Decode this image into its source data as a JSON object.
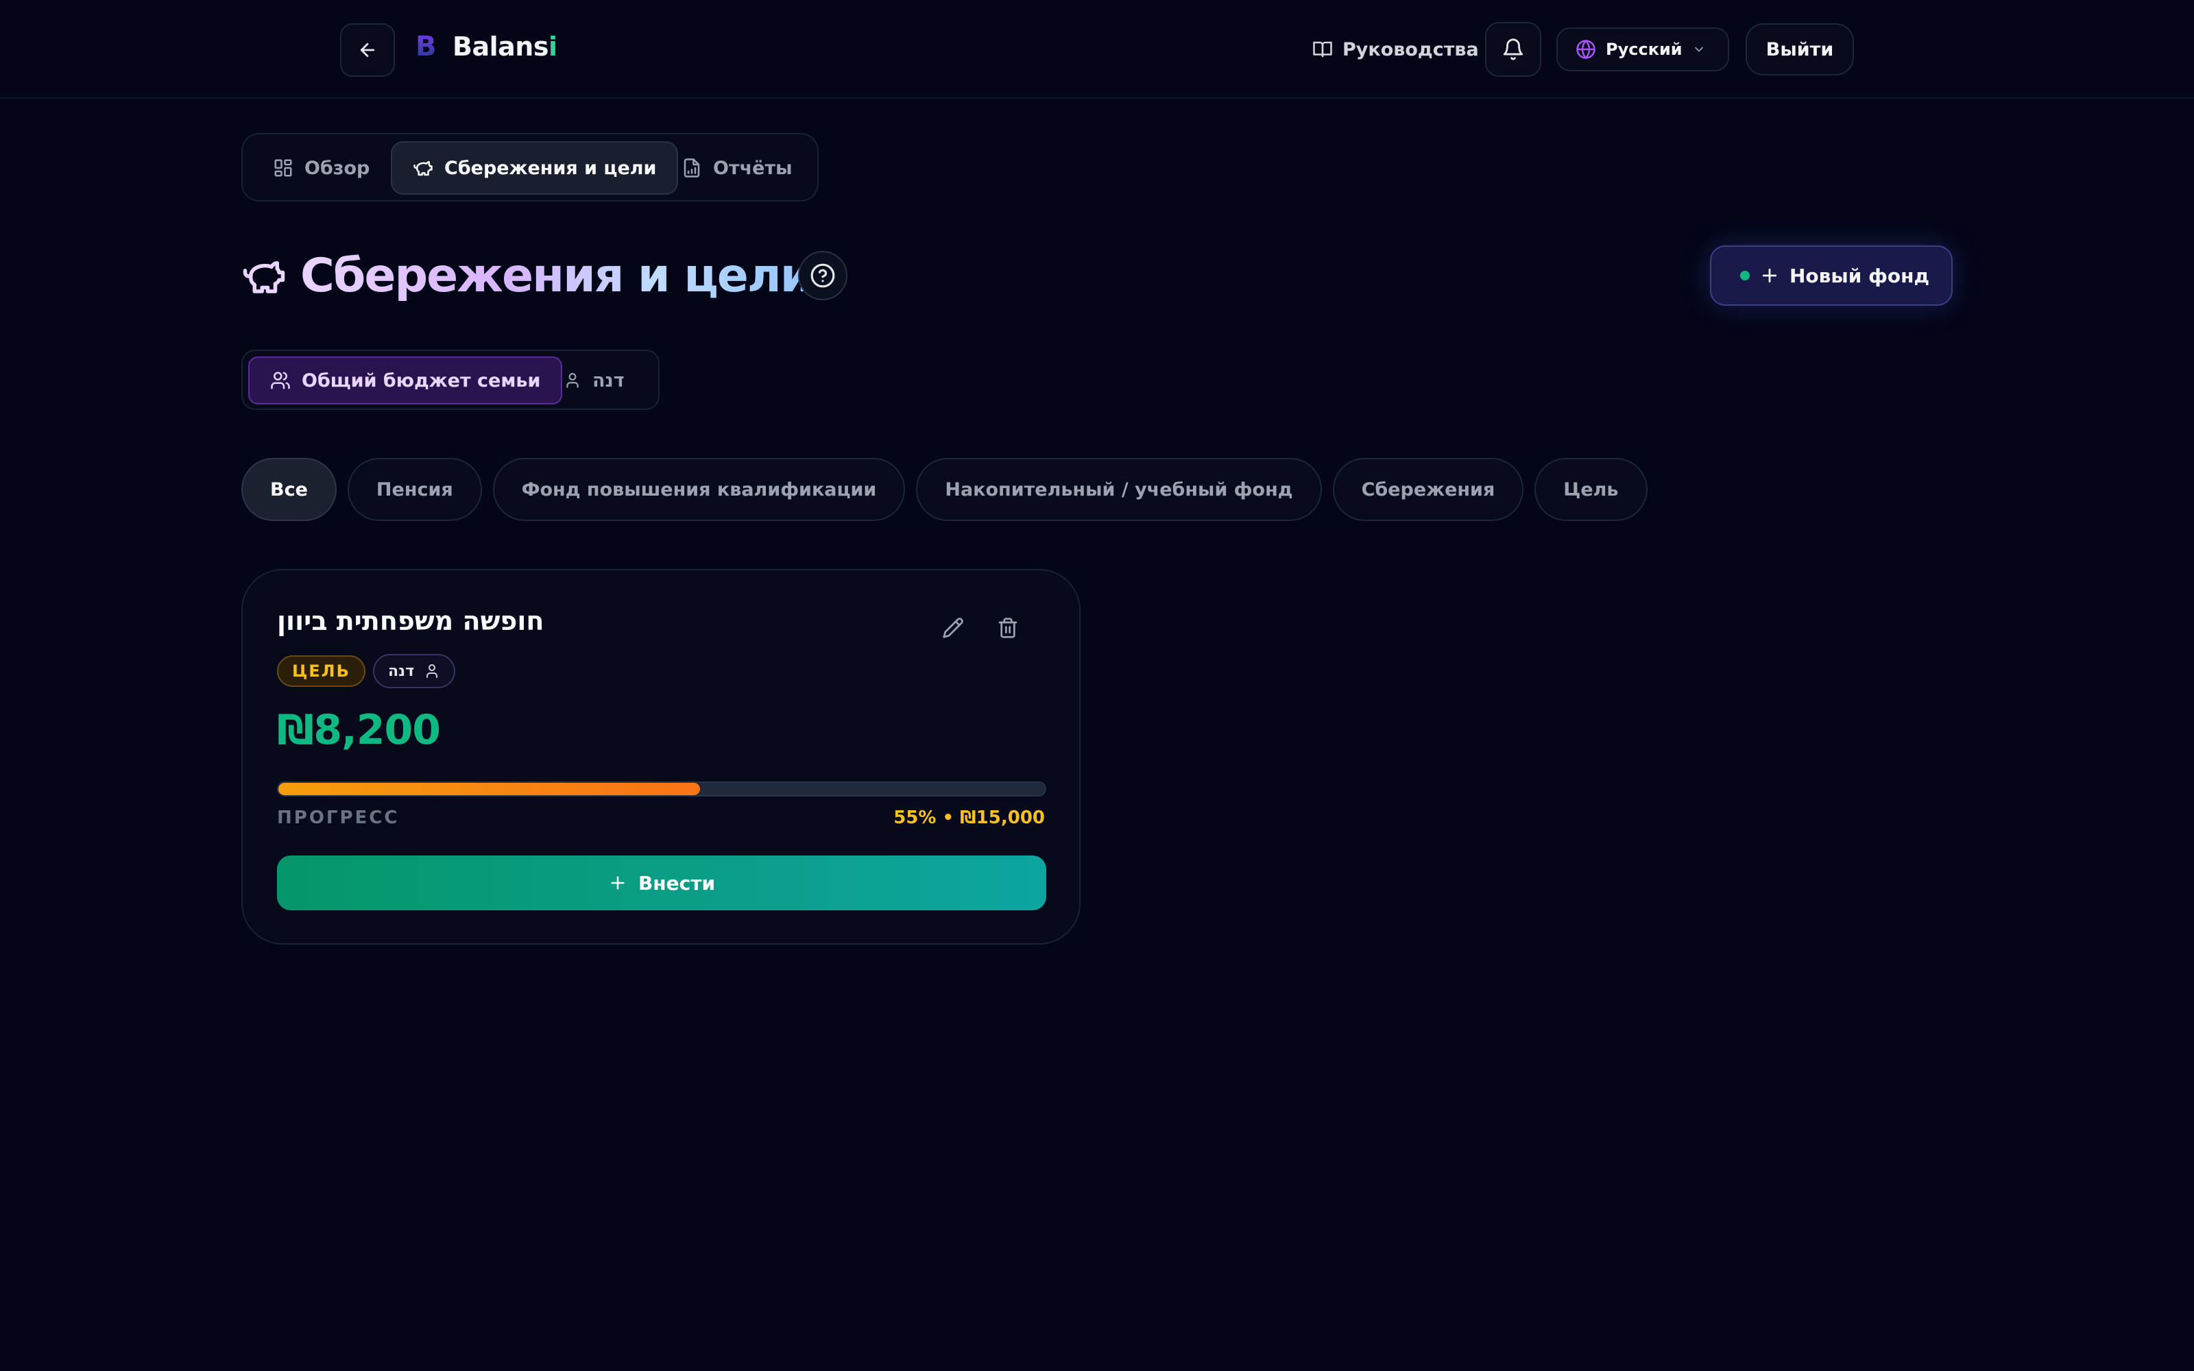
{
  "header": {
    "logo_mark": "B",
    "logo_text_main": "Balans",
    "logo_text_accent": "i",
    "guides_label": "Руководства",
    "language_label": "Русский",
    "logout_label": "Выйти"
  },
  "tabs": [
    {
      "label": "Обзор",
      "active": false,
      "icon": "grid-icon"
    },
    {
      "label": "Сбережения и цели",
      "active": true,
      "icon": "piggy-bank-icon"
    },
    {
      "label": "Отчёты",
      "active": false,
      "icon": "report-icon"
    }
  ],
  "page": {
    "title": "Сбережения и цели",
    "new_fund_label": "Новый фонд"
  },
  "scope": [
    {
      "label": "Общий бюджет семьи",
      "active": true,
      "icon": "users-icon"
    },
    {
      "label": "דנה",
      "active": false,
      "icon": "user-icon"
    }
  ],
  "filters": [
    {
      "label": "Все",
      "active": true
    },
    {
      "label": "Пенсия",
      "active": false
    },
    {
      "label": "Фонд повышения квалификации",
      "active": false
    },
    {
      "label": "Накопительный / учебный фонд",
      "active": false
    },
    {
      "label": "Сбережения",
      "active": false
    },
    {
      "label": "Цель",
      "active": false
    }
  ],
  "fund_card": {
    "title": "חופשה משפחתית ביוון",
    "type_badge": "ЦЕЛЬ",
    "owner_badge": "דנה",
    "amount": "₪8,200",
    "progress_label": "ПРОГРЕСС",
    "progress_meta": "55% • ₪15,000",
    "progress_fraction": 0.55,
    "deposit_label": "Внести"
  },
  "colors": {
    "background": "#030617",
    "accent_green": "#10b981",
    "accent_amber": "#fbbf24",
    "accent_purple": "#a855f7"
  }
}
